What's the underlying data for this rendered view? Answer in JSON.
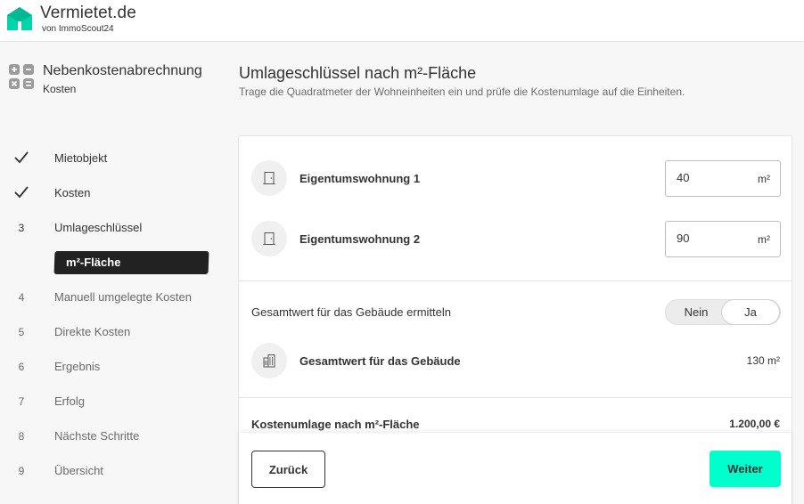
{
  "brand": {
    "name": "Vermietet.de",
    "sub": "von ImmoScout24",
    "color": "#00d4aa"
  },
  "sidebar": {
    "title": "Nebenkostenabrechnung",
    "subtitle": "Kosten",
    "steps": [
      {
        "marker": "check",
        "label": "Mietobjekt"
      },
      {
        "marker": "check",
        "label": "Kosten"
      },
      {
        "marker": "3",
        "label": "Umlageschlüssel"
      },
      {
        "marker": "4",
        "label": "Manuell umgelegte Kosten"
      },
      {
        "marker": "5",
        "label": "Direkte Kosten"
      },
      {
        "marker": "6",
        "label": "Ergebnis"
      },
      {
        "marker": "7",
        "label": "Erfolg"
      },
      {
        "marker": "8",
        "label": "Nächste Schritte"
      },
      {
        "marker": "9",
        "label": "Übersicht"
      }
    ],
    "active_substep": "m²-Fläche"
  },
  "main": {
    "title": "Umlageschlüssel nach m²-Fläche",
    "description": "Trage die Quadratmeter der Wohneinheiten ein und prüfe die Kostenumlage auf die Einheiten.",
    "units": [
      {
        "name": "Eigentumswohnung 1",
        "value": "40",
        "unit": "m²"
      },
      {
        "name": "Eigentumswohnung 2",
        "value": "90",
        "unit": "m²"
      }
    ],
    "building_question": "Gesamtwert für das Gebäude ermitteln",
    "toggle": {
      "no": "Nein",
      "yes": "Ja",
      "selected": "Ja"
    },
    "building_total_label": "Gesamtwert für das Gebäude",
    "building_total_value": "130 m²",
    "allocation_label": "Kostenumlage nach m²-Fläche",
    "allocation_value": "1.200,00 €"
  },
  "footer": {
    "back_label": "Zurück",
    "next_label": "Weiter",
    "accent": "#00ffcc"
  }
}
